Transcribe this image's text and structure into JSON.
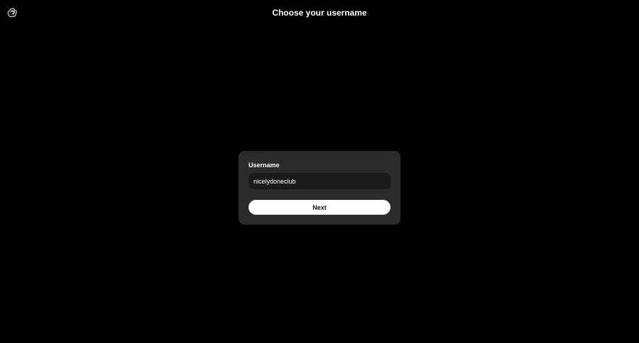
{
  "header": {
    "logo_icon": "openai-logo-icon",
    "title": "Choose your username"
  },
  "form": {
    "username_label": "Username",
    "username_value": "nicelydoneclub",
    "next_label": "Next"
  },
  "colors": {
    "background": "#000000",
    "card": "#2b2b2b",
    "input_bg": "#1b1b1b",
    "button_bg": "#ffffff",
    "text": "#ffffff"
  }
}
